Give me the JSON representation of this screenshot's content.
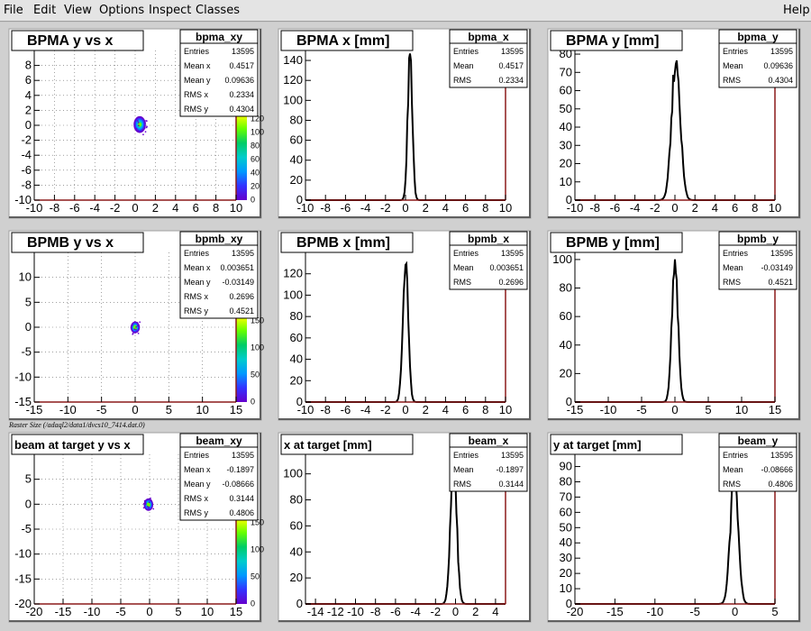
{
  "menu": {
    "items": [
      "File",
      "Edit",
      "View",
      "Options",
      "Inspect",
      "Classes"
    ],
    "help": "Help"
  },
  "raster_label": "Raster Size (/adaql2/data1/dvcs10_7414.dat.0)",
  "colors": {
    "axis_red": "#8b1a1a",
    "palette": [
      "#6600cc",
      "#3333ff",
      "#0099ff",
      "#00cccc",
      "#00cc66",
      "#66ff00",
      "#ffff00"
    ]
  },
  "pads": [
    {
      "id": "bpma-yx",
      "kind": "2d",
      "title": "BPMA y vs x",
      "stats": {
        "name": "bpma_xy",
        "rows": [
          [
            "Entries",
            "13595"
          ],
          [
            "Mean x",
            "0.4517"
          ],
          [
            "Mean y",
            "0.09636"
          ],
          [
            "RMS x",
            "0.2334"
          ],
          [
            "RMS y",
            "0.4304"
          ]
        ]
      },
      "chart_data": {
        "type": "heatmap",
        "xlim": [
          -10,
          10
        ],
        "ylim": [
          -10,
          10
        ],
        "xticks": [
          "-10",
          "-8",
          "-6",
          "-4",
          "-2",
          "0",
          "2",
          "4",
          "6",
          "8",
          "10"
        ],
        "yticks": [
          "-10",
          "-8",
          "-6",
          "-4",
          "-2",
          "0",
          "2",
          "4",
          "6",
          "8"
        ],
        "center": [
          0.4517,
          0.09636
        ],
        "rms": [
          0.2334,
          0.4304
        ],
        "zticks": [
          "0",
          "20",
          "40",
          "60",
          "80",
          "100",
          "120"
        ]
      }
    },
    {
      "id": "bpma-x",
      "kind": "1d",
      "title": "BPMA x [mm]",
      "stats": {
        "name": "bpma_x",
        "rows": [
          [
            "Entries",
            "13595"
          ],
          [
            "Mean",
            "0.4517"
          ],
          [
            "RMS",
            "0.2334"
          ]
        ]
      },
      "chart_data": {
        "type": "line",
        "xlim": [
          -10,
          10
        ],
        "ylim": [
          0,
          150
        ],
        "xticks": [
          "-10",
          "-8",
          "-6",
          "-4",
          "-2",
          "0",
          "2",
          "4",
          "6",
          "8",
          "10"
        ],
        "yticks": [
          "0",
          "20",
          "40",
          "60",
          "80",
          "100",
          "120",
          "140"
        ],
        "peak_x": 0.45,
        "peak_y": 143,
        "width": 0.23
      }
    },
    {
      "id": "bpma-y",
      "kind": "1d",
      "title": "BPMA y [mm]",
      "stats": {
        "name": "bpma_y",
        "rows": [
          [
            "Entries",
            "13595"
          ],
          [
            "Mean",
            "0.09636"
          ],
          [
            "RMS",
            "0.4304"
          ]
        ]
      },
      "chart_data": {
        "type": "line",
        "xlim": [
          -10,
          10
        ],
        "ylim": [
          0,
          82
        ],
        "xticks": [
          "-10",
          "-8",
          "-6",
          "-4",
          "-2",
          "0",
          "2",
          "4",
          "6",
          "8",
          "10"
        ],
        "yticks": [
          "0",
          "10",
          "20",
          "30",
          "40",
          "50",
          "60",
          "70",
          "80"
        ],
        "peak_x": 0.1,
        "peak_y": 78,
        "width": 0.43
      }
    },
    {
      "id": "bpmb-yx",
      "kind": "2d",
      "title": "BPMB y vs x",
      "stats": {
        "name": "bpmb_xy",
        "rows": [
          [
            "Entries",
            "13595"
          ],
          [
            "Mean x",
            "0.003651"
          ],
          [
            "Mean y",
            "-0.03149"
          ],
          [
            "RMS x",
            "0.2696"
          ],
          [
            "RMS y",
            "0.4521"
          ]
        ]
      },
      "chart_data": {
        "type": "heatmap",
        "xlim": [
          -15,
          15
        ],
        "ylim": [
          -15,
          15
        ],
        "xticks": [
          "-15",
          "-10",
          "-5",
          "0",
          "5",
          "10",
          "15"
        ],
        "yticks": [
          "-15",
          "-10",
          "-5",
          "0",
          "5",
          "10"
        ],
        "center": [
          0.003651,
          -0.03149
        ],
        "rms": [
          0.2696,
          0.4521
        ],
        "zticks": [
          "0",
          "50",
          "100",
          "150"
        ]
      }
    },
    {
      "id": "bpmb-x",
      "kind": "1d",
      "title": "BPMB x [mm]",
      "stats": {
        "name": "bpmb_x",
        "rows": [
          [
            "Entries",
            "13595"
          ],
          [
            "Mean",
            "0.003651"
          ],
          [
            "RMS",
            "0.2696"
          ]
        ]
      },
      "chart_data": {
        "type": "line",
        "xlim": [
          -10,
          10
        ],
        "ylim": [
          0,
          140
        ],
        "xticks": [
          "-10",
          "-8",
          "-6",
          "-4",
          "-2",
          "0",
          "2",
          "4",
          "6",
          "8",
          "10"
        ],
        "yticks": [
          "0",
          "20",
          "40",
          "60",
          "80",
          "100",
          "120"
        ],
        "peak_x": 0.0,
        "peak_y": 133,
        "width": 0.27
      }
    },
    {
      "id": "bpmb-y",
      "kind": "1d",
      "title": "BPMB y [mm]",
      "stats": {
        "name": "bpmb_y",
        "rows": [
          [
            "Entries",
            "13595"
          ],
          [
            "Mean",
            "-0.03149"
          ],
          [
            "RMS",
            "0.4521"
          ]
        ]
      },
      "chart_data": {
        "type": "line",
        "xlim": [
          -15,
          15
        ],
        "ylim": [
          0,
          105
        ],
        "xticks": [
          "-15",
          "-10",
          "-5",
          "0",
          "5",
          "10",
          "15"
        ],
        "yticks": [
          "0",
          "20",
          "40",
          "60",
          "80",
          "100"
        ],
        "peak_x": 0.0,
        "peak_y": 101,
        "width": 0.45
      }
    },
    {
      "id": "beam-yx",
      "kind": "2d",
      "title": "beam at target y vs x",
      "stats": {
        "name": "beam_xy",
        "rows": [
          [
            "Entries",
            "13595"
          ],
          [
            "Mean x",
            "-0.1897"
          ],
          [
            "Mean y",
            "-0.08666"
          ],
          [
            "RMS x",
            "0.3144"
          ],
          [
            "RMS y",
            "0.4806"
          ]
        ]
      },
      "chart_data": {
        "type": "heatmap",
        "xlim": [
          -20,
          15
        ],
        "ylim": [
          -20,
          10
        ],
        "xticks": [
          "-20",
          "-15",
          "-10",
          "-5",
          "0",
          "5",
          "10",
          "15"
        ],
        "yticks": [
          "-20",
          "-15",
          "-10",
          "-5",
          "0",
          "5"
        ],
        "center": [
          -0.1897,
          -0.08666
        ],
        "rms": [
          0.3144,
          0.4806
        ],
        "zticks": [
          "0",
          "50",
          "100",
          "150"
        ]
      }
    },
    {
      "id": "beam-x",
      "kind": "1d",
      "title": "x at target [mm]",
      "stats": {
        "name": "beam_x",
        "rows": [
          [
            "Entries",
            "13595"
          ],
          [
            "Mean",
            "-0.1897"
          ],
          [
            "RMS",
            "0.3144"
          ]
        ]
      },
      "chart_data": {
        "type": "line",
        "xlim": [
          -15,
          5
        ],
        "ylim": [
          0,
          115
        ],
        "xticks": [
          "-14",
          "-12",
          "-10",
          "-8",
          "-6",
          "-4",
          "-2",
          "0",
          "2",
          "4"
        ],
        "xtickvals": [
          -14,
          -12,
          -10,
          -8,
          -6,
          -4,
          -2,
          0,
          2,
          4
        ],
        "yticks": [
          "0",
          "20",
          "40",
          "60",
          "80",
          "100"
        ],
        "peak_x": -0.19,
        "peak_y": 108,
        "width": 0.31
      }
    },
    {
      "id": "beam-y",
      "kind": "1d",
      "title": "y at target [mm]",
      "stats": {
        "name": "beam_y",
        "rows": [
          [
            "Entries",
            "13595"
          ],
          [
            "Mean",
            "-0.08666"
          ],
          [
            "RMS",
            "0.4806"
          ]
        ]
      },
      "chart_data": {
        "type": "line",
        "xlim": [
          -20,
          5
        ],
        "ylim": [
          0,
          98
        ],
        "xticks": [
          "-20",
          "-15",
          "-10",
          "-5",
          "0",
          "5"
        ],
        "yticks": [
          "0",
          "10",
          "20",
          "30",
          "40",
          "50",
          "60",
          "70",
          "80",
          "90"
        ],
        "peak_x": -0.09,
        "peak_y": 85,
        "width": 0.48
      }
    }
  ]
}
